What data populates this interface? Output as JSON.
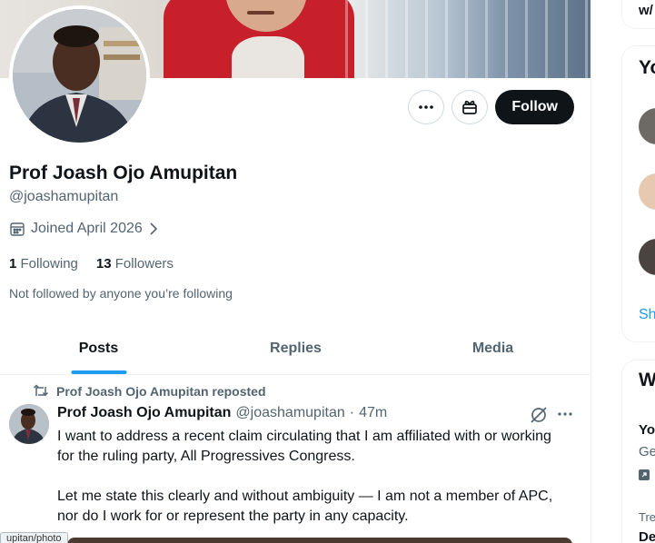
{
  "profile": {
    "name": "Prof Joash Ojo Amupitan",
    "handle": "@joashamupitan",
    "joined": "Joined April 2026",
    "following_count": "1",
    "following_label": "Following",
    "followers_count": "13",
    "followers_label": "Followers",
    "not_followed": "Not followed by anyone you’re following"
  },
  "actions": {
    "more_icon": "more-horizontal-icon",
    "gift_icon": "gift-icon",
    "follow_label": "Follow"
  },
  "tabs": [
    {
      "label": "Posts",
      "active": true
    },
    {
      "label": "Replies",
      "active": false
    },
    {
      "label": "Media",
      "active": false
    }
  ],
  "post": {
    "repost_label": "Prof Joash Ojo Amupitan reposted",
    "author_name": "Prof Joash Ojo Amupitan",
    "author_handle": "@joashamupitan",
    "separator": "·",
    "time": "47m",
    "paragraph1": "I want to address a recent claim circulating that I am affiliated with or working for the ruling party, All Progressives Congress.",
    "paragraph2": "Let me state this clearly and without ambiguity — I am not a member of APC, nor do I work for or represent the party in any capacity."
  },
  "tooltip": "upitan/photo",
  "sidebar": {
    "top_partial": "w/",
    "you_might_like_partial": "Yo",
    "show_more_partial": "Sh",
    "whats_happening_partial": "W",
    "trend1_partial": "Yo",
    "trend1_sub_partial": "Ge",
    "trend2_context_partial": "Tre",
    "trend2_partial": "De"
  },
  "colors": {
    "accent": "#1d9bf0",
    "follow_bg": "#0f1419",
    "muted_text": "#536471"
  }
}
